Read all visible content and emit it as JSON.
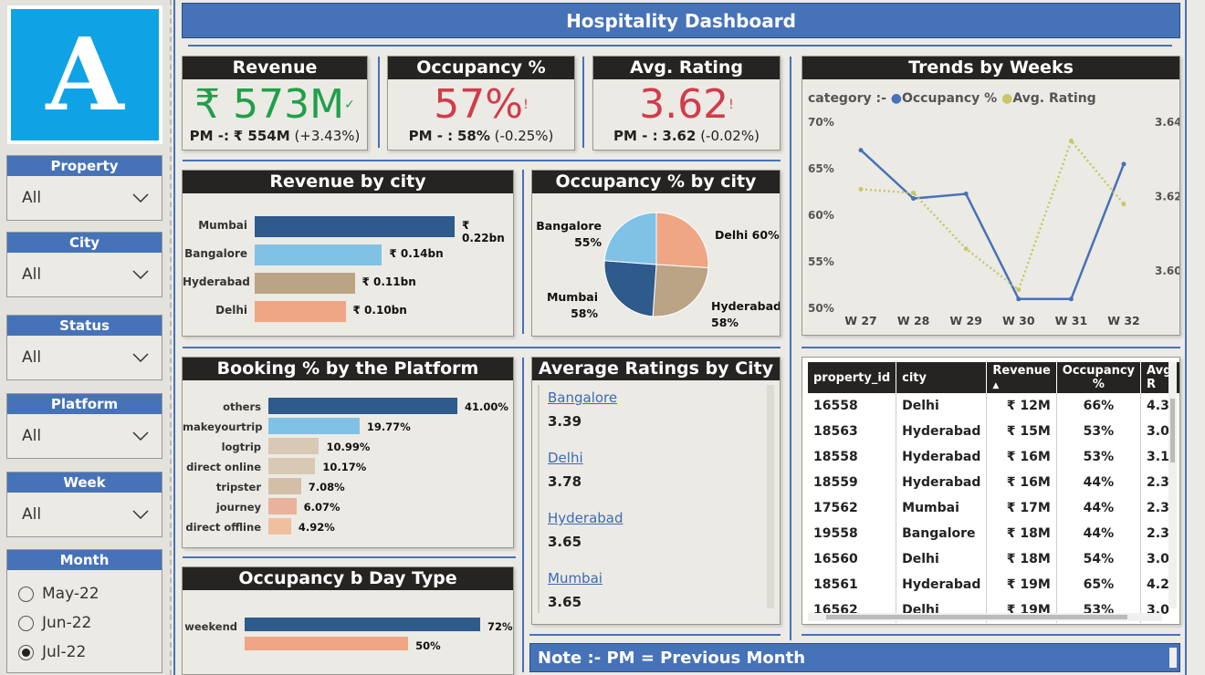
{
  "header": {
    "title": "Hospitality Dashboard"
  },
  "logo": {
    "letter": "A"
  },
  "slicers": [
    {
      "label": "Property",
      "value": "All"
    },
    {
      "label": "City",
      "value": "All"
    },
    {
      "label": "Status",
      "value": "All"
    },
    {
      "label": "Platform",
      "value": "All"
    },
    {
      "label": "Week",
      "value": "All"
    }
  ],
  "month": {
    "label": "Month",
    "options": [
      "May-22",
      "Jun-22",
      "Jul-22"
    ],
    "selected": "Jul-22"
  },
  "kpis": {
    "revenue": {
      "title": "Revenue",
      "value": "₹ 573M",
      "pm_label": "PM -:",
      "pm_value": "₹ 554M",
      "pm_change": "(+3.43%)",
      "color": "#1fa04a",
      "mark": "✓"
    },
    "occupancy": {
      "title": "Occupancy %",
      "value": "57%",
      "pm_label": "PM - :",
      "pm_value": "58%",
      "pm_change": "(-0.25%)",
      "color": "#d13c4b",
      "mark": "!"
    },
    "rating": {
      "title": "Avg. Rating",
      "value": "3.62",
      "pm_label": "PM - :",
      "pm_value": "3.62",
      "pm_change": "(-0.02%)",
      "color": "#d13c4b",
      "mark": "!"
    }
  },
  "revenue_by_city": {
    "title": "Revenue by city"
  },
  "occupancy_by_city": {
    "title": "Occupancy % by city"
  },
  "trends": {
    "title": "Trends by Weeks",
    "legend_label": "category :-",
    "series_names": [
      "Occupancy %",
      "Avg. Rating"
    ],
    "left_ticks": [
      "70%",
      "65%",
      "60%",
      "55%",
      "50%"
    ],
    "right_ticks": [
      "3.64",
      "3.62",
      "3.60"
    ]
  },
  "booking": {
    "title": "Booking % by the Platform"
  },
  "ratings_by_city": {
    "title": "Average Ratings by City",
    "items": [
      {
        "city": "Bangalore",
        "rating": "3.39"
      },
      {
        "city": "Delhi",
        "rating": "3.78"
      },
      {
        "city": "Hyderabad",
        "rating": "3.65"
      },
      {
        "city": "Mumbai",
        "rating": "3.65"
      }
    ]
  },
  "daytype": {
    "title": "Occupancy b Day Type"
  },
  "table": {
    "columns": [
      "property_id",
      "city",
      "Revenue",
      "Occupancy %",
      "Avg. R"
    ],
    "rows": [
      [
        "16558",
        "Delhi",
        "₹ 12M",
        "66%",
        "4.3"
      ],
      [
        "18563",
        "Hyderabad",
        "₹ 15M",
        "53%",
        "3.0"
      ],
      [
        "18558",
        "Hyderabad",
        "₹ 16M",
        "53%",
        "3.1"
      ],
      [
        "18559",
        "Hyderabad",
        "₹ 16M",
        "44%",
        "2.3"
      ],
      [
        "17562",
        "Mumbai",
        "₹ 17M",
        "44%",
        "2.3"
      ],
      [
        "19558",
        "Bangalore",
        "₹ 18M",
        "44%",
        "2.3"
      ],
      [
        "16560",
        "Delhi",
        "₹ 18M",
        "54%",
        "3.0"
      ],
      [
        "18561",
        "Hyderabad",
        "₹ 19M",
        "65%",
        "4.2"
      ],
      [
        "16562",
        "Delhi",
        "₹ 19M",
        "53%",
        "3.0"
      ]
    ]
  },
  "note": {
    "text": "Note :-  PM = Previous Month"
  },
  "colors": {
    "accent": "#4672b8",
    "dark": "#252423",
    "bg": "#eceae4"
  },
  "chart_data": [
    {
      "type": "bar",
      "title": "Revenue by city",
      "orientation": "horizontal",
      "categories": [
        "Mumbai",
        "Bangalore",
        "Hyderabad",
        "Delhi"
      ],
      "values": [
        0.22,
        0.14,
        0.11,
        0.1
      ],
      "labels": [
        "₹ 0.22bn",
        "₹ 0.14bn",
        "₹ 0.11bn",
        "₹ 0.10bn"
      ],
      "colors": [
        "#2e5a8c",
        "#7fc2e6",
        "#bba386",
        "#efa684"
      ]
    },
    {
      "type": "pie",
      "title": "Occupancy % by city",
      "slices": [
        {
          "name": "Delhi",
          "value": 60,
          "label": "Delhi 60%",
          "color": "#efa684"
        },
        {
          "name": "Hyderabad",
          "value": 58,
          "label": "Hyderabad 58%",
          "color": "#bba386"
        },
        {
          "name": "Mumbai",
          "value": 58,
          "label": "Mumbai 58%",
          "color": "#2e5a8c"
        },
        {
          "name": "Bangalore",
          "value": 55,
          "label": "Bangalore 55%",
          "color": "#7fc2e6"
        }
      ]
    },
    {
      "type": "line",
      "title": "Trends by Weeks",
      "x": [
        "W 27",
        "W 28",
        "W 29",
        "W 30",
        "W 31",
        "W 32"
      ],
      "series": [
        {
          "name": "Occupancy %",
          "axis": "left",
          "values": [
            67,
            61.8,
            62.3,
            51,
            51,
            65.5
          ],
          "color": "#4672b8",
          "style": "solid"
        },
        {
          "name": "Avg. Rating",
          "axis": "right",
          "values": [
            3.622,
            3.621,
            3.606,
            3.595,
            3.635,
            3.618
          ],
          "color": "#c7c76a",
          "style": "dotted"
        }
      ],
      "ylim_left": [
        50,
        70
      ],
      "ylim_right": [
        3.59,
        3.64
      ]
    },
    {
      "type": "bar",
      "title": "Booking % by the Platform",
      "orientation": "horizontal",
      "categories": [
        "others",
        "makeyourtrip",
        "logtrip",
        "direct online",
        "tripster",
        "journey",
        "direct offline"
      ],
      "values": [
        41.0,
        19.77,
        10.99,
        10.17,
        7.08,
        6.07,
        4.92
      ],
      "labels": [
        "41.00%",
        "19.77%",
        "10.99%",
        "10.17%",
        "7.08%",
        "6.07%",
        "4.92%"
      ],
      "colors": [
        "#2e5a8c",
        "#7fc2e6",
        "#d8c9b5",
        "#d8c9b5",
        "#d3bfa8",
        "#e8b29c",
        "#efbf9e"
      ]
    },
    {
      "type": "bar",
      "title": "Occupancy b Day Type",
      "orientation": "horizontal",
      "categories": [
        "weekend",
        ""
      ],
      "values": [
        72,
        50
      ],
      "labels": [
        "72%",
        "50%"
      ],
      "colors": [
        "#2e5a8c",
        "#efa684"
      ]
    }
  ]
}
